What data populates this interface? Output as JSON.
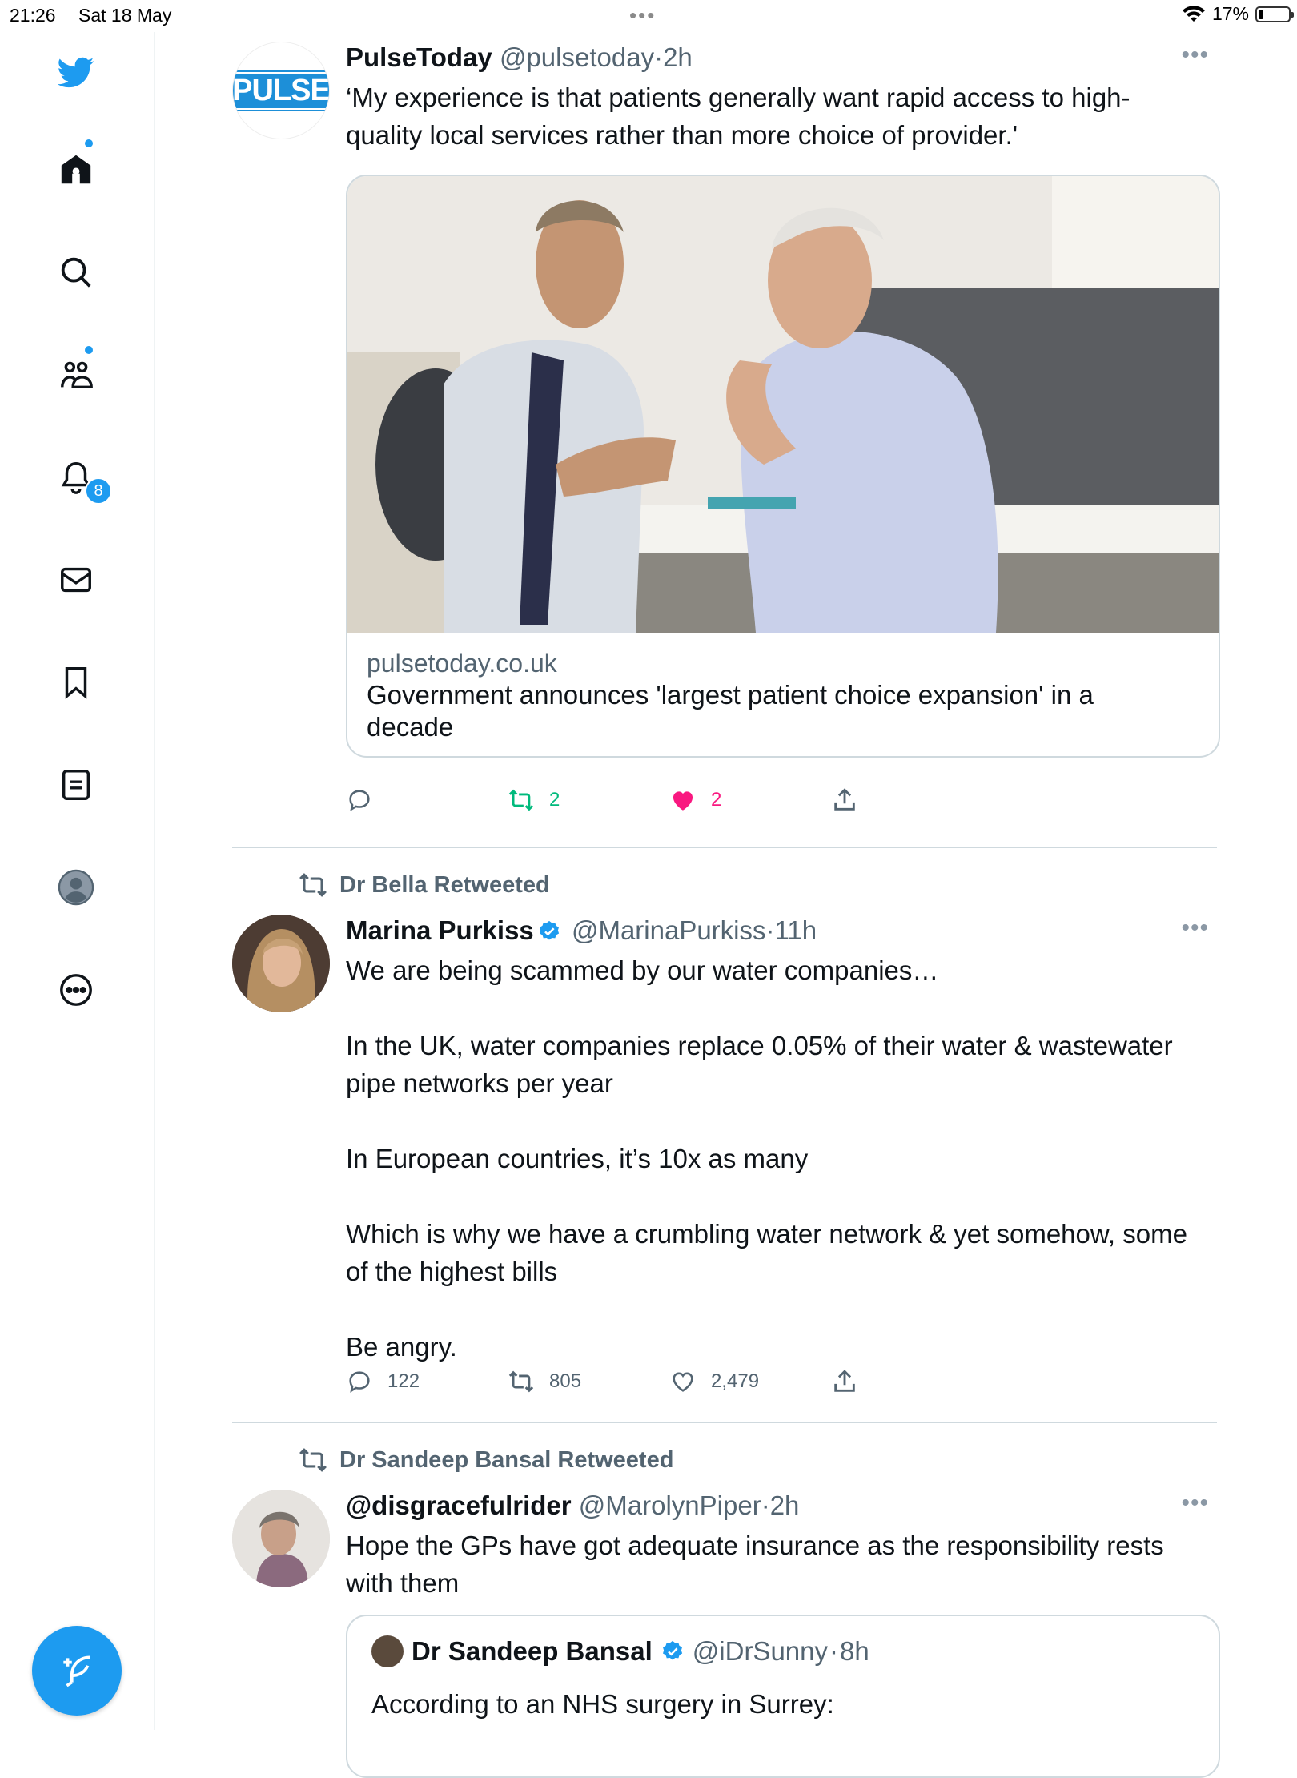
{
  "status_bar": {
    "time": "21:26",
    "date": "Sat 18 May",
    "battery": "17%",
    "battery_level": 0.17
  },
  "sidebar": {
    "items": [
      {
        "icon": "twitter-bird-icon"
      },
      {
        "icon": "home-icon",
        "dot": true
      },
      {
        "icon": "search-icon"
      },
      {
        "icon": "communities-icon",
        "dot": true
      },
      {
        "icon": "notifications-icon",
        "badge": "8"
      },
      {
        "icon": "messages-icon"
      },
      {
        "icon": "bookmarks-icon"
      },
      {
        "icon": "lists-icon"
      },
      {
        "icon": "profile-icon"
      },
      {
        "icon": "more-icon"
      }
    ],
    "compose_icon": "compose-icon",
    "accent": "#1d9bf0"
  },
  "tweets": [
    {
      "name": "PulseToday",
      "handle": "@pulsetoday",
      "sep": "·",
      "time": "2h",
      "avatar_text": "PULSE",
      "text": "‘My experience is that patients generally want rapid access to high-quality local services rather than more choice of provider.'",
      "card": {
        "domain": "pulsetoday.co.uk",
        "title": "Government announces 'largest patient choice expansion' in a decade"
      },
      "retweets": "2",
      "likes": "2",
      "liked": true,
      "retweeted": true
    },
    {
      "retweeted_by": "Dr Bella Retweeted",
      "name": "Marina Purkiss",
      "verified": true,
      "handle": "@MarinaPurkiss",
      "sep": "·",
      "time": "11h",
      "paragraphs": [
        "We are being scammed by our water companies…",
        "In the UK, water companies replace 0.05% of their water & wastewater pipe networks per year",
        "In European countries, it’s 10x as many",
        "Which is why we have a crumbling water network & yet somehow, some of the highest bills",
        "Be angry."
      ],
      "replies": "122",
      "retweets": "805",
      "likes": "2,479"
    },
    {
      "retweeted_by": "Dr Sandeep Bansal Retweeted",
      "name": "@disgracefulrider",
      "handle": "@MarolynPiper",
      "sep": "·",
      "time": "2h",
      "text": "Hope the GPs have got adequate insurance as the responsibility rests with them",
      "quote": {
        "name": "Dr Sandeep Bansal",
        "verified": true,
        "handle": "@iDrSunny",
        "sep": "·",
        "time": "8h",
        "text": "According to an NHS surgery in Surrey:"
      }
    }
  ],
  "colors": {
    "retweet_green": "#00ba7c",
    "like_pink": "#f91880",
    "muted": "#536471"
  }
}
